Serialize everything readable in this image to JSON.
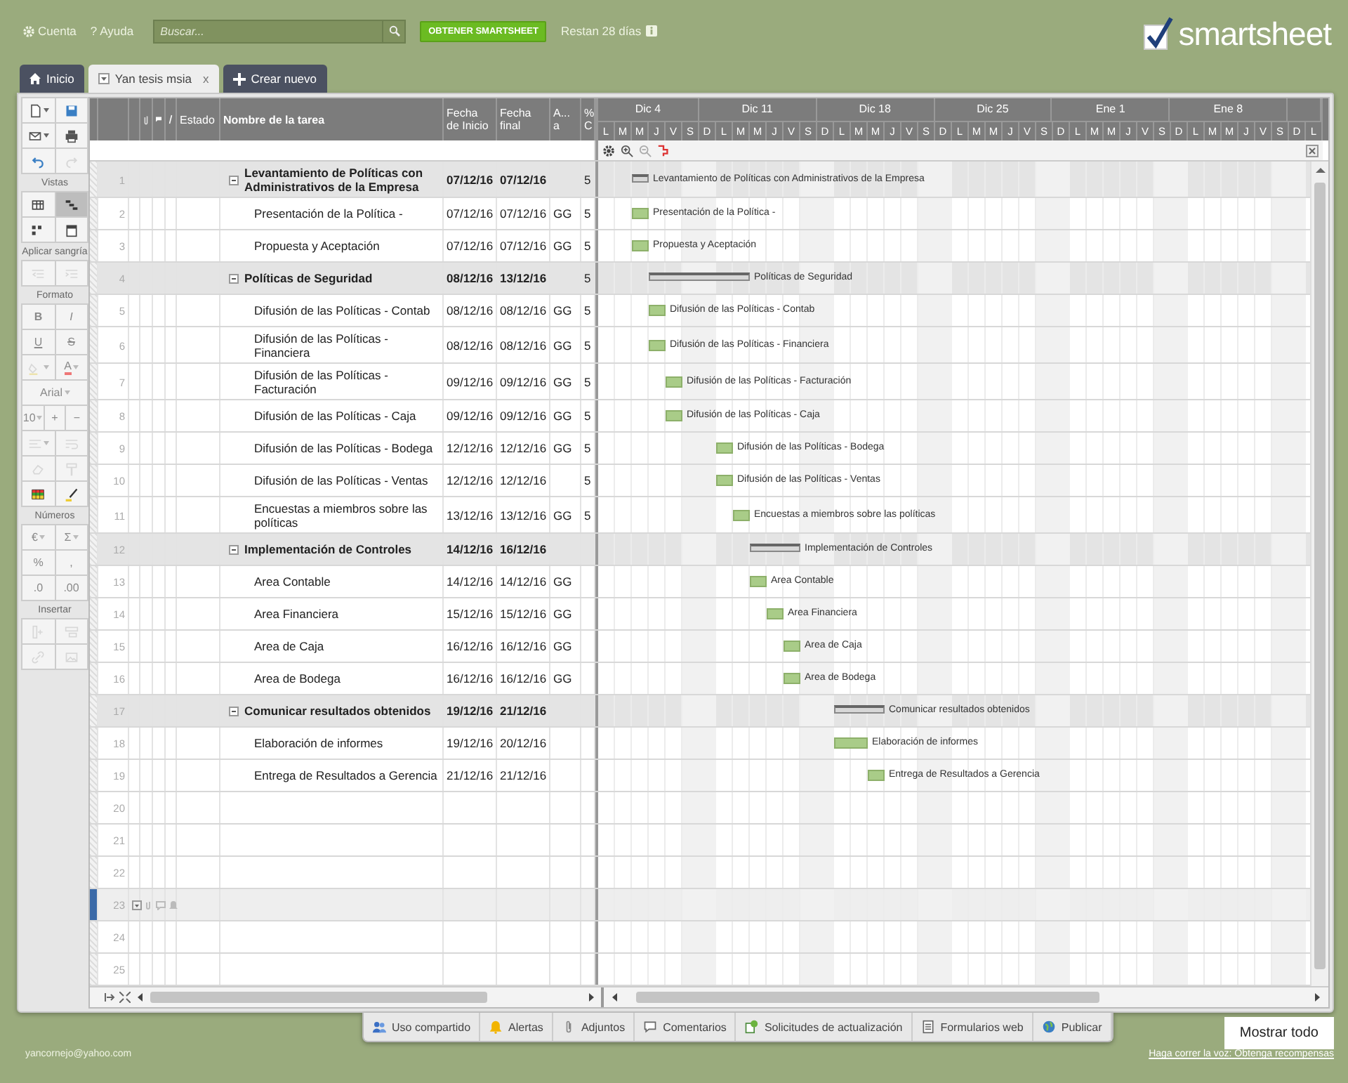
{
  "top_bar": {
    "account": {
      "label": "Cuenta"
    },
    "help": {
      "glyph": "?",
      "label": "Ayuda"
    },
    "search": {
      "placeholder": "Buscar..."
    },
    "get_button": "OBTENER SMARTSHEET",
    "trial": "Restan 28 días",
    "logo": "smartsheet"
  },
  "tabs": [
    {
      "kind": "home",
      "label": "Inicio",
      "selected": false
    },
    {
      "kind": "sheet",
      "label": "Yan tesis msia",
      "close": "x",
      "selected": true
    },
    {
      "kind": "new",
      "label": "Crear nuevo",
      "selected": false
    }
  ],
  "toolbar": [
    {
      "buttons": [
        {
          "kind": "new",
          "menu": true,
          "disabled": false
        },
        {
          "kind": "save",
          "disabled": false
        },
        {
          "kind": "mail",
          "menu": true,
          "disabled": false
        },
        {
          "kind": "print",
          "disabled": false
        },
        {
          "kind": "undo",
          "disabled": false
        },
        {
          "kind": "redo",
          "disabled": true
        }
      ]
    },
    {
      "label": "Vistas",
      "buttons": [
        {
          "kind": "grid",
          "selected": false,
          "disabled": false
        },
        {
          "kind": "gantt",
          "selected": true,
          "disabled": false
        },
        {
          "kind": "card",
          "selected": false,
          "disabled": false
        },
        {
          "kind": "calendar",
          "selected": false,
          "disabled": false
        }
      ]
    },
    {
      "label": "Aplicar sangría",
      "buttons": [
        {
          "kind": "outdent",
          "disabled": true
        },
        {
          "kind": "indent",
          "disabled": true
        }
      ]
    },
    {
      "label": "Formato",
      "buttons": [
        {
          "kind": "bold",
          "text": "B",
          "disabled": true
        },
        {
          "kind": "italic",
          "text": "I",
          "disabled": true
        },
        {
          "kind": "underline",
          "text": "U",
          "disabled": true
        },
        {
          "kind": "strike",
          "text": "S",
          "disabled": true
        },
        {
          "kind": "fill",
          "menu": true,
          "disabled": true
        },
        {
          "kind": "fontcolor",
          "text": "A",
          "menu": true,
          "disabled": true
        },
        {
          "kind": "font-select",
          "text": "Arial",
          "menu": true,
          "disabled": true
        },
        {
          "kind": "size-select",
          "text": "10",
          "menu": true,
          "disabled": true
        },
        {
          "kind": "size-up",
          "text": "+",
          "disabled": true
        },
        {
          "kind": "size-down",
          "text": "−",
          "disabled": true
        },
        {
          "kind": "align",
          "menu": true,
          "disabled": true
        },
        {
          "kind": "wrap",
          "disabled": true
        },
        {
          "kind": "clear",
          "disabled": true
        },
        {
          "kind": "paint",
          "disabled": true
        },
        {
          "kind": "cellcolor",
          "disabled": false
        },
        {
          "kind": "highlight",
          "disabled": false
        }
      ]
    },
    {
      "label": "Números",
      "buttons": [
        {
          "kind": "currency",
          "text": "€",
          "menu": true,
          "disabled": true
        },
        {
          "kind": "sum",
          "text": "Σ",
          "menu": true,
          "disabled": true
        },
        {
          "kind": "percent",
          "text": "%",
          "disabled": true
        },
        {
          "kind": "comma",
          "text": ",",
          "disabled": true
        },
        {
          "kind": "decrease-decimals",
          "text": ".0",
          "disabled": true
        },
        {
          "kind": "increase-decimals",
          "text": ".00",
          "disabled": true
        }
      ]
    },
    {
      "label": "Insertar",
      "buttons": [
        {
          "kind": "insert-col",
          "disabled": true
        },
        {
          "kind": "insert-row",
          "disabled": true
        },
        {
          "kind": "link",
          "disabled": true
        },
        {
          "kind": "image",
          "disabled": true
        }
      ]
    }
  ],
  "table": {
    "columns": [
      "Estado",
      "Nombre de la tarea",
      "Fecha de Inicio",
      "Fecha final",
      "A... a",
      "% C"
    ],
    "rows": [
      {
        "num": "1",
        "kind": "summary",
        "expanded": true,
        "selected": false,
        "name": "Levantamiento de Políticas con Administrativos de la Empresa",
        "start": "07/12/16",
        "end": "07/12/16",
        "pct": "5",
        "bar_label": "Levantamiento de Políticas con Administrativos de la Empresa",
        "children": [
          {
            "num": "2",
            "kind": "task",
            "selected": false,
            "name": "Presentación de la Política -",
            "start": "07/12/16",
            "end": "07/12/16",
            "assigned": "GG",
            "pct": "5",
            "bar_label": "Presentación de la Política -"
          },
          {
            "num": "3",
            "kind": "task",
            "selected": false,
            "name": "Propuesta y Aceptación",
            "start": "07/12/16",
            "end": "07/12/16",
            "assigned": "GG",
            "pct": "5",
            "bar_label": "Propuesta y Aceptación"
          }
        ]
      },
      {
        "num": "4",
        "kind": "summary",
        "expanded": true,
        "selected": false,
        "name": "Políticas de Seguridad",
        "start": "08/12/16",
        "end": "13/12/16",
        "pct": "5",
        "bar_label": "Políticas de Seguridad",
        "children": [
          {
            "num": "5",
            "kind": "task",
            "selected": false,
            "name": "Difusión de las Políticas - Contab",
            "start": "08/12/16",
            "end": "08/12/16",
            "assigned": "GG",
            "pct": "5",
            "bar_label": "Difusión de las Políticas - Contab"
          },
          {
            "num": "6",
            "kind": "task",
            "selected": false,
            "name": "Difusión de las Políticas - Financiera",
            "start": "08/12/16",
            "end": "08/12/16",
            "assigned": "GG",
            "pct": "5",
            "bar_label": "Difusión de las Políticas - Financiera"
          },
          {
            "num": "7",
            "kind": "task",
            "selected": false,
            "name": "Difusión de las Políticas - Facturación",
            "start": "09/12/16",
            "end": "09/12/16",
            "assigned": "GG",
            "pct": "5",
            "bar_label": "Difusión de las Políticas - Facturación"
          },
          {
            "num": "8",
            "kind": "task",
            "selected": false,
            "name": "Difusión de las Políticas - Caja",
            "start": "09/12/16",
            "end": "09/12/16",
            "assigned": "GG",
            "pct": "5",
            "bar_label": "Difusión de las Políticas - Caja"
          },
          {
            "num": "9",
            "kind": "task",
            "selected": false,
            "name": "Difusión de las Políticas - Bodega",
            "start": "12/12/16",
            "end": "12/12/16",
            "assigned": "GG",
            "pct": "5",
            "bar_label": "Difusión de las Políticas - Bodega"
          },
          {
            "num": "10",
            "kind": "task",
            "selected": false,
            "name": "Difusión de las Políticas - Ventas",
            "start": "12/12/16",
            "end": "12/12/16",
            "pct": "5",
            "bar_label": "Difusión de las Políticas - Ventas"
          },
          {
            "num": "11",
            "kind": "task",
            "selected": false,
            "name": "Encuestas a miembros sobre las políticas",
            "start": "13/12/16",
            "end": "13/12/16",
            "assigned": "GG",
            "pct": "5",
            "bar_label": "Encuestas a miembros sobre las políticas"
          }
        ]
      },
      {
        "num": "12",
        "kind": "summary",
        "expanded": true,
        "selected": false,
        "name": "Implementación de Controles",
        "start": "14/12/16",
        "end": "16/12/16",
        "bar_label": "Implementación de Controles",
        "children": [
          {
            "num": "13",
            "kind": "task",
            "selected": false,
            "name": "Area Contable",
            "start": "14/12/16",
            "end": "14/12/16",
            "assigned": "GG",
            "bar_label": "Area Contable"
          },
          {
            "num": "14",
            "kind": "task",
            "selected": false,
            "name": "Area Financiera",
            "start": "15/12/16",
            "end": "15/12/16",
            "assigned": "GG",
            "bar_label": "Area Financiera"
          },
          {
            "num": "15",
            "kind": "task",
            "selected": false,
            "name": "Area de Caja",
            "start": "16/12/16",
            "end": "16/12/16",
            "assigned": "GG",
            "bar_label": "Area de Caja"
          },
          {
            "num": "16",
            "kind": "task",
            "selected": false,
            "name": "Area de Bodega",
            "start": "16/12/16",
            "end": "16/12/16",
            "assigned": "GG",
            "bar_label": "Area de Bodega"
          }
        ]
      },
      {
        "num": "17",
        "kind": "summary",
        "expanded": true,
        "selected": false,
        "name": "Comunicar resultados obtenidos",
        "start": "19/12/16",
        "end": "21/12/16",
        "bar_label": "Comunicar resultados obtenidos",
        "children": [
          {
            "num": "18",
            "kind": "task",
            "selected": false,
            "name": "Elaboración de informes",
            "start": "19/12/16",
            "end": "20/12/16",
            "bar_label": "Elaboración de informes"
          },
          {
            "num": "19",
            "kind": "task",
            "selected": false,
            "name": "Entrega de Resultados a Gerencia",
            "start": "21/12/16",
            "end": "21/12/16",
            "bar_label": "Entrega de Resultados a Gerencia"
          }
        ]
      },
      {
        "num": "20",
        "kind": "empty",
        "selected": false
      },
      {
        "num": "21",
        "kind": "empty",
        "selected": false
      },
      {
        "num": "22",
        "kind": "empty",
        "selected": false
      },
      {
        "num": "23",
        "kind": "empty",
        "selected": true
      },
      {
        "num": "24",
        "kind": "empty",
        "selected": false
      },
      {
        "num": "25",
        "kind": "empty",
        "selected": false
      }
    ]
  },
  "gantt": {
    "weeks": [
      {
        "label": "Dic 4",
        "days": [
          "L",
          "M",
          "M",
          "J",
          "V",
          "S"
        ]
      },
      {
        "label": "Dic 11",
        "days": [
          "D",
          "L",
          "M",
          "M",
          "J",
          "V",
          "S"
        ]
      },
      {
        "label": "Dic 18",
        "days": [
          "D",
          "L",
          "M",
          "M",
          "J",
          "V",
          "S"
        ]
      },
      {
        "label": "Dic 25",
        "days": [
          "D",
          "L",
          "M",
          "M",
          "J",
          "V",
          "S"
        ]
      },
      {
        "label": "Ene 1",
        "days": [
          "D",
          "L",
          "M",
          "M",
          "J",
          "V",
          "S"
        ]
      },
      {
        "label": "Ene 8",
        "days": [
          "D",
          "L",
          "M",
          "M",
          "J",
          "V",
          "S"
        ]
      },
      {
        "days": [
          "D",
          "L"
        ]
      }
    ]
  },
  "bottom_toolbar": [
    {
      "kind": "share",
      "label": "Uso compartido"
    },
    {
      "kind": "alerts",
      "label": "Alertas"
    },
    {
      "kind": "attachments",
      "label": "Adjuntos"
    },
    {
      "kind": "comments",
      "label": "Comentarios"
    },
    {
      "kind": "requests",
      "label": "Solicitudes de actualización"
    },
    {
      "kind": "forms",
      "label": "Formularios web"
    },
    {
      "kind": "publish",
      "label": "Publicar"
    }
  ],
  "footer": {
    "email": "yancornejo@yahoo.com",
    "show_all": "Mostrar todo",
    "link": "Haga correr la voz: Obtenga recompensas"
  }
}
